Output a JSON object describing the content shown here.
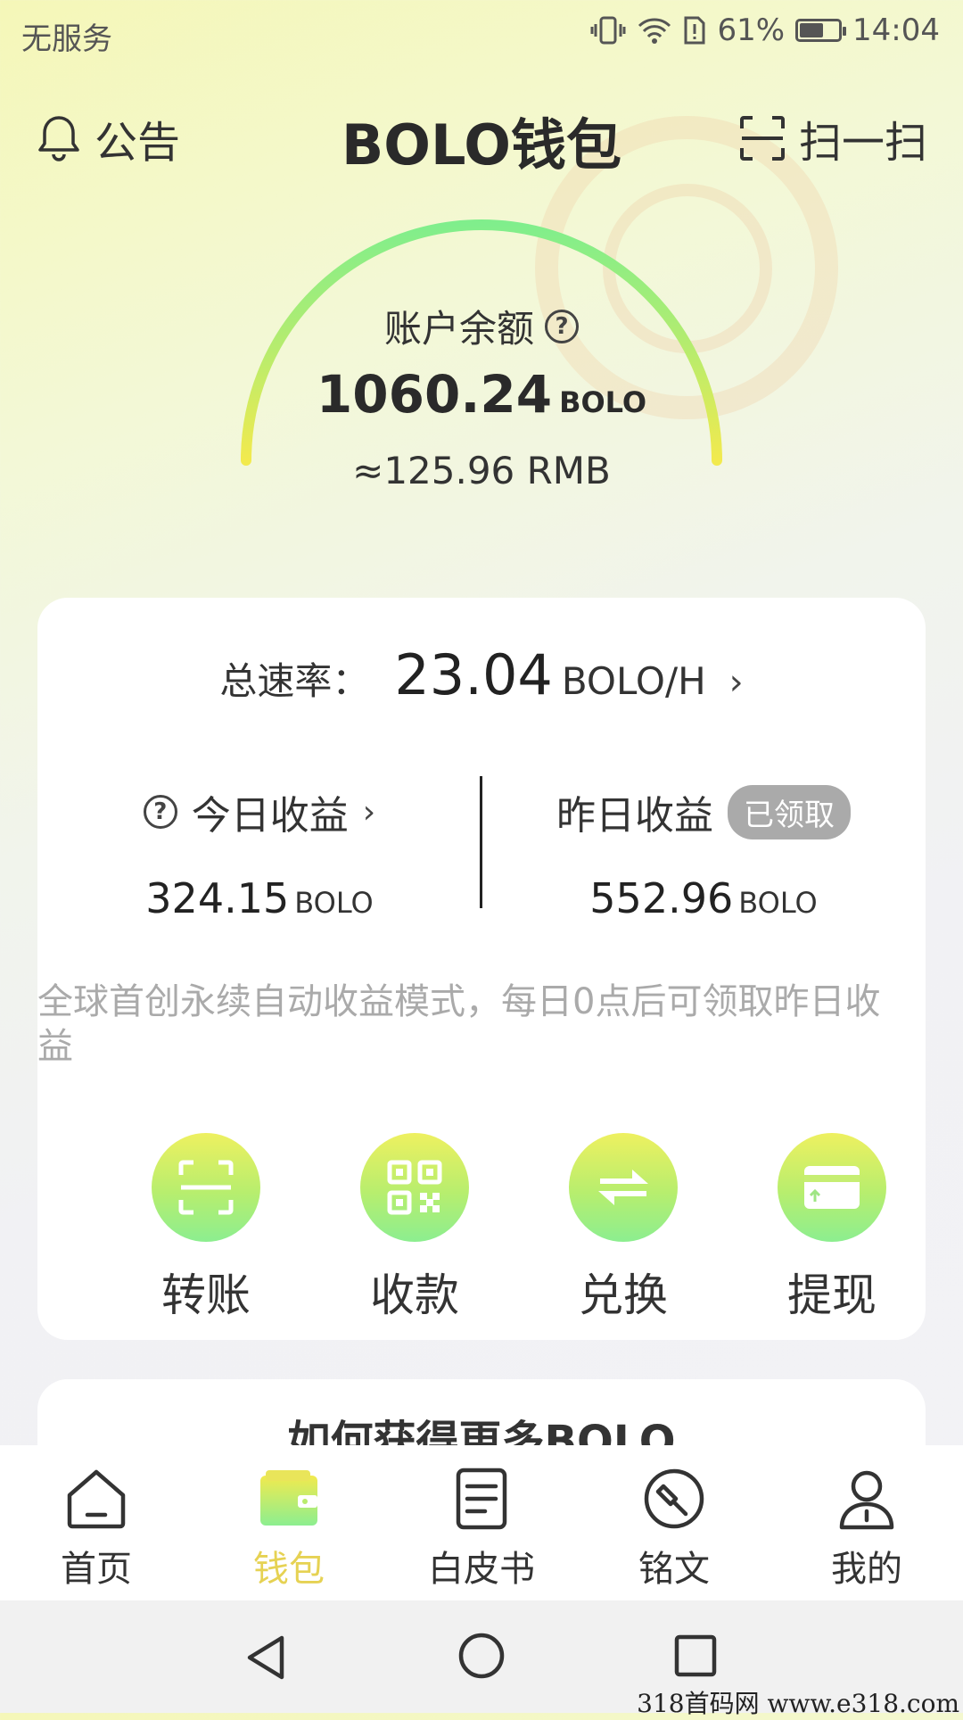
{
  "status_bar": {
    "carrier": "无服务",
    "battery": "61%",
    "time": "14:04",
    "battery_level": 0.61
  },
  "header": {
    "announce_label": "公告",
    "title": "BOLO钱包",
    "scan_label": "扫一扫"
  },
  "balance": {
    "label": "账户余额",
    "value": "1060.24",
    "unit": "BOLO",
    "rmb": "≈125.96 RMB"
  },
  "rate": {
    "label": "总速率：",
    "value": "23.04",
    "unit": "BOLO/H"
  },
  "today": {
    "label": "今日收益",
    "value": "324.15",
    "unit": "BOLO"
  },
  "yesterday": {
    "label": "昨日收益",
    "badge": "已领取",
    "value": "552.96",
    "unit": "BOLO"
  },
  "notice": "全球首创永续自动收益模式，每日0点后可领取昨日收益",
  "actions": [
    {
      "label": "转账",
      "icon": "transfer-scan-icon"
    },
    {
      "label": "收款",
      "icon": "qr-code-icon"
    },
    {
      "label": "兑换",
      "icon": "exchange-arrows-icon"
    },
    {
      "label": "提现",
      "icon": "card-withdraw-icon"
    }
  ],
  "next_card_title": "如何获得更多BOLO",
  "bottom_nav": [
    {
      "label": "首页",
      "icon": "home-icon",
      "active": false
    },
    {
      "label": "钱包",
      "icon": "wallet-icon",
      "active": true
    },
    {
      "label": "白皮书",
      "icon": "document-icon",
      "active": false
    },
    {
      "label": "铭文",
      "icon": "hammer-icon",
      "active": false
    },
    {
      "label": "我的",
      "icon": "user-icon",
      "active": false
    }
  ],
  "colors": {
    "active": "#e6d253",
    "accent_green": "#8cee90",
    "accent_yellow": "#eef060"
  },
  "watermark": "318首码网 www.e318.com"
}
